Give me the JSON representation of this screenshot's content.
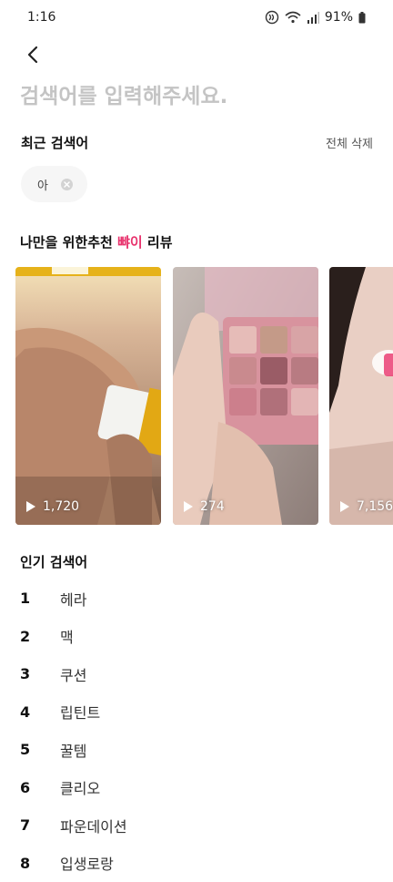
{
  "status": {
    "time": "1:16",
    "battery": "91%"
  },
  "search": {
    "placeholder": "검색어를 입력해주세요."
  },
  "recent": {
    "title": "최근 검색어",
    "clear_all": "전체 삭제",
    "chips": [
      "아"
    ]
  },
  "recommend": {
    "title_prefix": "나만을 위한추천",
    "title_accent": "뺘이",
    "title_suffix": "리뷰",
    "accent_color": "#e8336d",
    "cards": [
      {
        "views": "1,720"
      },
      {
        "views": "274"
      },
      {
        "views": "7,156"
      }
    ]
  },
  "popular": {
    "title": "인기 검색어",
    "items": [
      {
        "rank": "1",
        "term": "헤라"
      },
      {
        "rank": "2",
        "term": "맥"
      },
      {
        "rank": "3",
        "term": "쿠션"
      },
      {
        "rank": "4",
        "term": "립틴트"
      },
      {
        "rank": "5",
        "term": "꿀템"
      },
      {
        "rank": "6",
        "term": "클리오"
      },
      {
        "rank": "7",
        "term": "파운데이션"
      },
      {
        "rank": "8",
        "term": "입생로랑"
      }
    ]
  }
}
